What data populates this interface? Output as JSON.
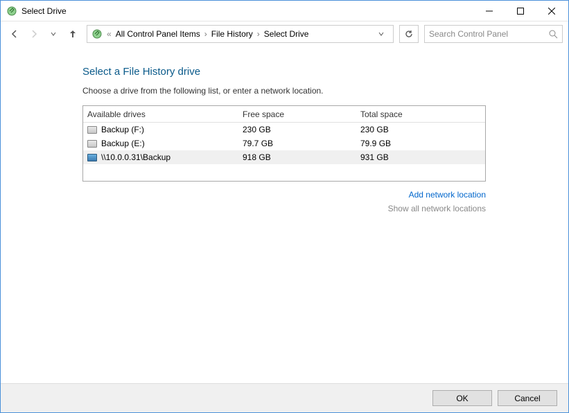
{
  "window": {
    "title": "Select Drive"
  },
  "breadcrumb": {
    "prefix": "«",
    "items": [
      "All Control Panel Items",
      "File History",
      "Select Drive"
    ]
  },
  "search": {
    "placeholder": "Search Control Panel"
  },
  "main": {
    "heading": "Select a File History drive",
    "subhead": "Choose a drive from the following list, or enter a network location."
  },
  "table": {
    "headers": [
      "Available drives",
      "Free space",
      "Total space"
    ],
    "rows": [
      {
        "icon": "drive",
        "name": "Backup (F:)",
        "free": "230 GB",
        "total": "230 GB",
        "selected": false
      },
      {
        "icon": "drive",
        "name": "Backup (E:)",
        "free": "79.7 GB",
        "total": "79.9 GB",
        "selected": false
      },
      {
        "icon": "net",
        "name": "\\\\10.0.0.31\\Backup",
        "free": "918 GB",
        "total": "931 GB",
        "selected": true
      }
    ]
  },
  "links": {
    "add": "Add network location",
    "show": "Show all network locations"
  },
  "footer": {
    "ok": "OK",
    "cancel": "Cancel"
  }
}
